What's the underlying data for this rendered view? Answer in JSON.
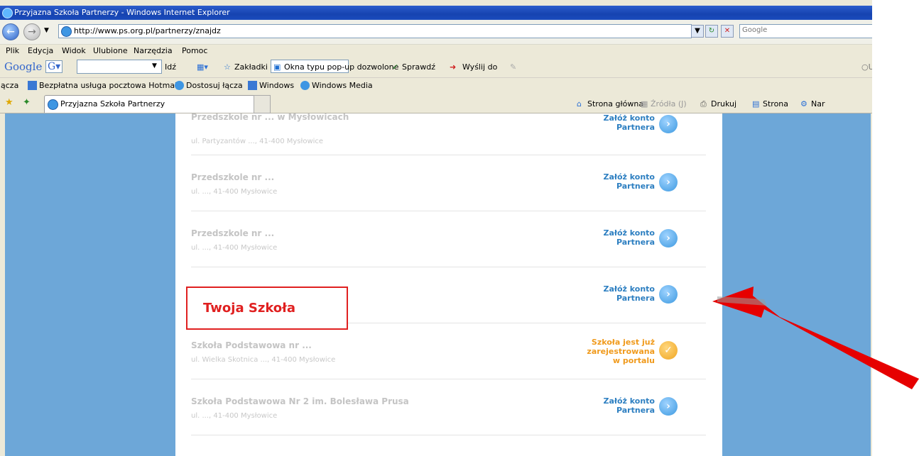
{
  "window": {
    "title": "Przyjazna Szkoła Partnerzy - Windows Internet Explorer"
  },
  "address_bar": {
    "url": "http://www.ps.org.pl/partnerzy/znajdz",
    "search_placeholder": "Google"
  },
  "menu": [
    "Plik",
    "Edycja",
    "Widok",
    "Ulubione",
    "Narzędzia",
    "Pomoc"
  ],
  "google_toolbar": {
    "logo": "Google",
    "go": "Idź",
    "bookmarks": "Zakładki",
    "popups": "Okna typu pop-up dozwolone",
    "spell": "Sprawdź",
    "send": "Wyślij do"
  },
  "links_bar": {
    "label": "ącza",
    "items": [
      "Bezpłatna usługa pocztowa Hotmail",
      "Dostosuj łącza",
      "Windows",
      "Windows Media"
    ]
  },
  "tab": {
    "title": "Przyjazna Szkoła Partnerzy"
  },
  "command_bar": {
    "home": "Strona główna",
    "feeds": "Źródła (J)",
    "print": "Drukuj",
    "page": "Strona",
    "tools": "Nar"
  },
  "schools": [
    {
      "name": "Przedszkole nr ... w Mysłowicach",
      "address": "ul. Partyzantów ..., 41-400 Mysłowice",
      "action": "Załóż konto Partnera",
      "status": "blue"
    },
    {
      "name": "Przedszkole nr ...",
      "address": "ul. ..., 41-400 Mysłowice",
      "action": "Załóż konto Partnera",
      "status": "blue"
    },
    {
      "name": "Przedszkole nr ...",
      "address": "ul. ..., 41-400 Mysłowice",
      "action": "Załóż konto Partnera",
      "status": "blue"
    },
    {
      "name": "",
      "address": "",
      "action": "Załóż konto Partnera",
      "status": "blue"
    },
    {
      "name": "Szkoła Podstawowa nr ...",
      "address": "ul. Wielka Skotnica ..., 41-400 Mysłowice",
      "action": "Szkoła jest już zarejestrowana w portalu",
      "status": "orange"
    },
    {
      "name": "Szkoła Podstawowa Nr 2 im. Bolesława Prusa",
      "address": "ul. ..., 41-400 Mysłowice",
      "action": "Załóż konto Partnera",
      "status": "blue"
    }
  ],
  "highlight": {
    "label": "Twoja Szkoła"
  },
  "colors": {
    "accent_blue": "#2d7fc1",
    "accent_orange": "#f09a1c",
    "highlight_red": "#e02020",
    "background": "#6da7d8"
  }
}
